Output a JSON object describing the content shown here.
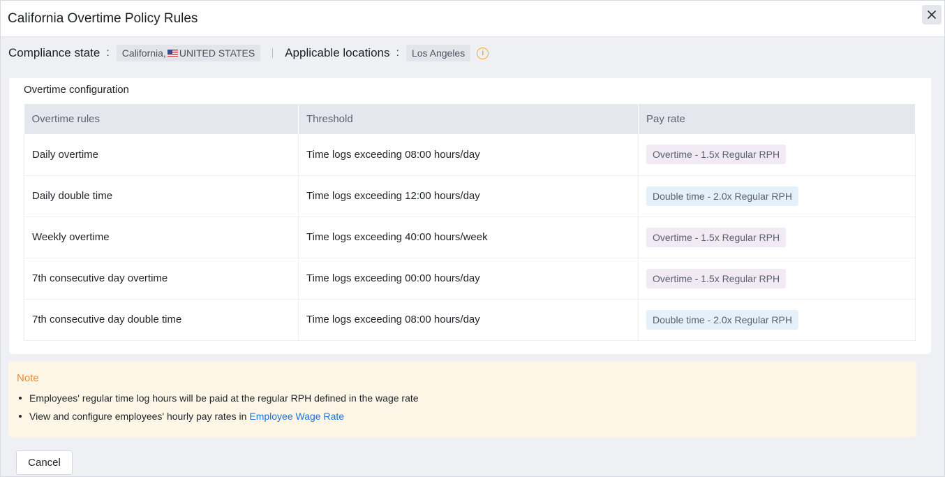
{
  "modal": {
    "title": "California Overtime Policy Rules"
  },
  "meta": {
    "compliance_label": "Compliance state",
    "colon": ":",
    "state_value": "California,",
    "country_value": "UNITED STATES",
    "locations_label": "Applicable locations",
    "location_value": "Los Angeles"
  },
  "config": {
    "section_title": "Overtime configuration",
    "headers": [
      "Overtime rules",
      "Threshold",
      "Pay rate"
    ],
    "rows": [
      {
        "rule": "Daily overtime",
        "threshold": "Time logs exceeding 08:00 hours/day",
        "pay": "Overtime - 1.5x Regular RPH"
      },
      {
        "rule": "Daily double time",
        "threshold": "Time logs exceeding 12:00 hours/day",
        "pay": "Double time - 2.0x Regular RPH"
      },
      {
        "rule": "Weekly overtime",
        "threshold": "Time logs exceeding 40:00 hours/week",
        "pay": "Overtime - 1.5x Regular RPH"
      },
      {
        "rule": "7th consecutive day overtime",
        "threshold": "Time logs exceeding 00:00 hours/day",
        "pay": "Overtime - 1.5x Regular RPH"
      },
      {
        "rule": "7th consecutive day double time",
        "threshold": "Time logs exceeding 08:00 hours/day",
        "pay": "Double time - 2.0x Regular RPH"
      }
    ]
  },
  "note": {
    "title": "Note",
    "line1": "Employees' regular time log hours will be paid at the regular RPH defined in the wage rate",
    "line2_prefix": "View and configure employees' hourly pay rates in",
    "line2_link": "Employee Wage Rate"
  },
  "footer": {
    "cancel_label": "Cancel"
  },
  "icons": {
    "close": "close-icon",
    "info": "info-icon",
    "flag": "us-flag-icon"
  },
  "colors": {
    "note_title": "#ef8a2c",
    "link": "#1a73d9",
    "overtime_chip": "#f1eaf5",
    "doubletime_chip": "#e4f1fa"
  }
}
